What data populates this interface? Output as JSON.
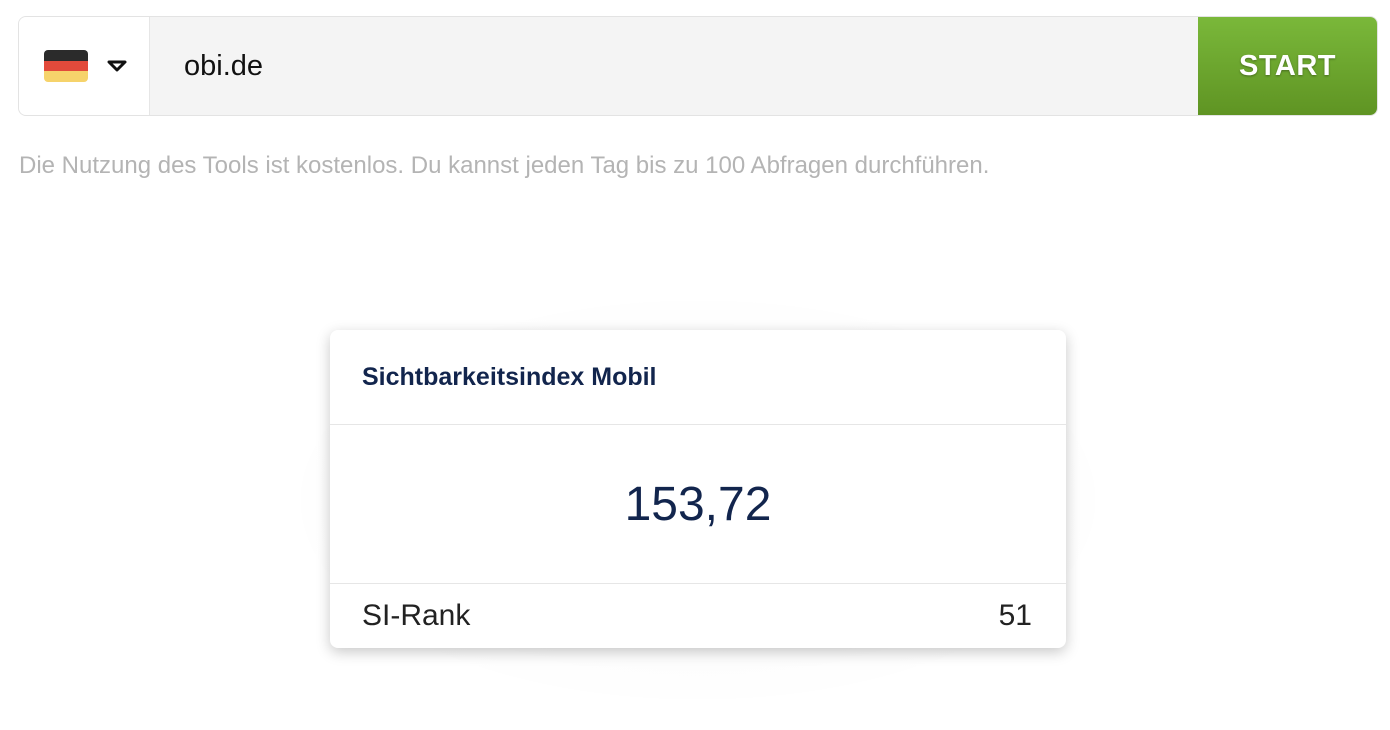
{
  "search": {
    "country_icon": "germany-flag-icon",
    "flag_colors": [
      "#2b2b2b",
      "#e24a3b",
      "#f6d36b"
    ],
    "dropdown_icon": "chevron-down-icon",
    "domain_value": "obi.de",
    "start_label": "START",
    "start_color": "#6aa52d"
  },
  "note": "Die Nutzung des Tools ist kostenlos. Du kannst jeden Tag bis zu 100 Abfragen durchführen.",
  "card": {
    "title": "Sichtbarkeitsindex Mobil",
    "value": "153,72",
    "rank_label": "SI-Rank",
    "rank_value": "51",
    "accent_color": "#12254d"
  }
}
